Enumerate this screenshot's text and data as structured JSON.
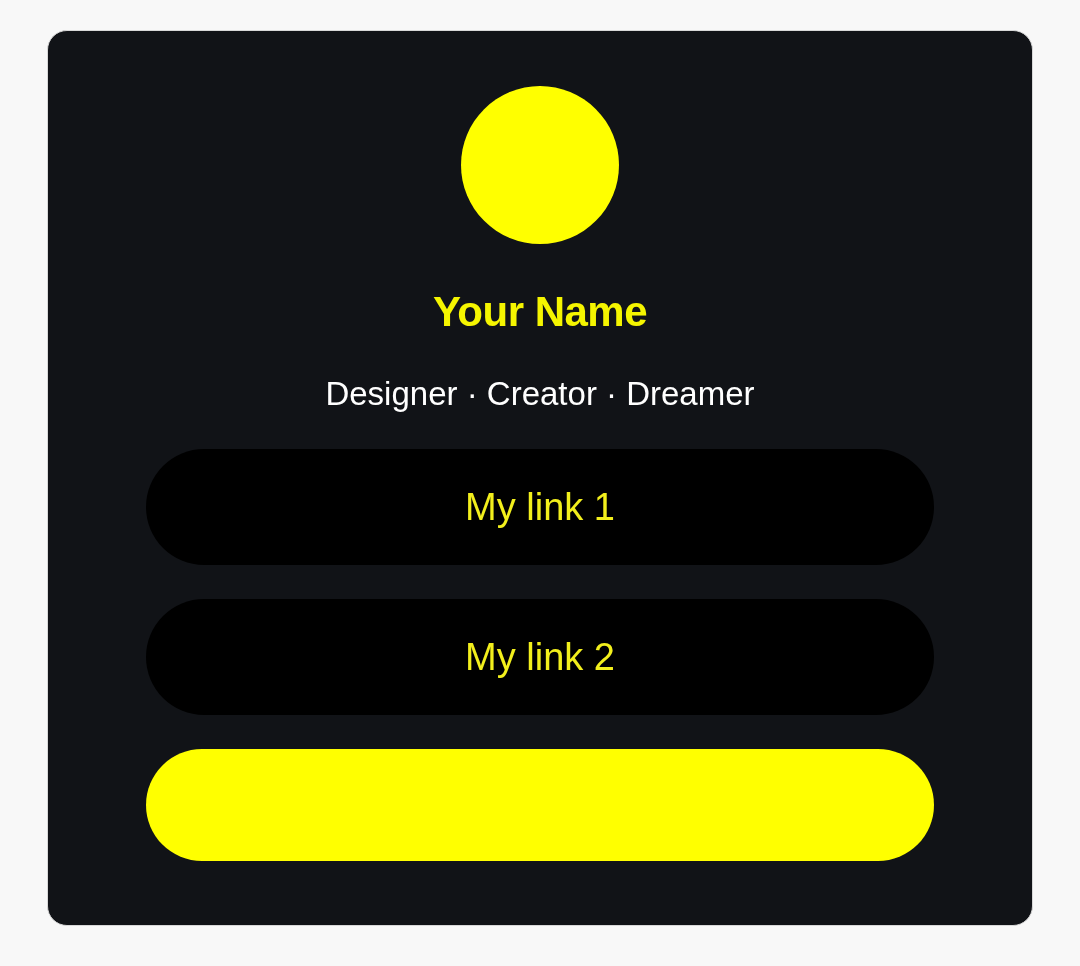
{
  "profile": {
    "name": "Your Name",
    "tagline": "Designer · Creator · Dreamer"
  },
  "links": [
    {
      "label": "My link 1",
      "highlighted": false
    },
    {
      "label": "My link 2",
      "highlighted": false
    },
    {
      "highlighted": true
    }
  ]
}
